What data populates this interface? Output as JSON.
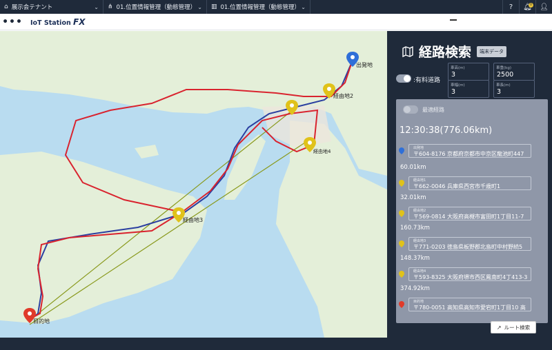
{
  "topbar": {
    "tenant": "展示会テナント",
    "menu1": "01.位置情報管理（動態管理）",
    "menu2": "01.位置情報管理（動態管理）",
    "badge": "0"
  },
  "header": {
    "logo_main": "IoT Station",
    "logo_fx": "FX"
  },
  "map": {
    "labels": {
      "origin": "出発地",
      "via2": "経由地2",
      "via3": "経由地3",
      "via4": "経由地4",
      "dest": "目的地"
    },
    "colors": {
      "route_red": "#d9232e",
      "route_blue": "#2b3fa0",
      "route_olive": "#8a9a1e",
      "water": "#b9dcf0",
      "land": "#e4efd9"
    }
  },
  "panel": {
    "title": "経路検索",
    "tag": "端末データ",
    "fields": {
      "height_label": "車高(m)",
      "height": "3",
      "weight_label": "車重(kg)",
      "weight": "2500",
      "width_label": "車幅(m)",
      "width": "3",
      "length_label": "車長(m)",
      "length": "3"
    },
    "toll_label": ":有料道路",
    "optimal_label": "最適経路",
    "total": "12:30:38(776.06km)",
    "stops": [
      {
        "label": "出発地",
        "addr": "〒604-8176 京都府京都市中京区龍池町447",
        "color": "#2f6fd8"
      },
      {
        "label": "経由地1",
        "addr": "〒662-0046 兵庫県西宮市千歳町1",
        "color": "#e0c21a"
      },
      {
        "label": "経由地2",
        "addr": "〒569-0814 大阪府高槻市富田町1丁目11-7",
        "color": "#e0c21a"
      },
      {
        "label": "経由地3",
        "addr": "〒771-0203 徳島県板野郡北島町中村野続5",
        "color": "#e0c21a"
      },
      {
        "label": "経由地4",
        "addr": "〒593-8325 大阪府堺市西区鳳南町4丁413-3",
        "color": "#e0c21a"
      },
      {
        "label": "目的地",
        "addr": "〒780-0051 高知県高知市愛宕町1丁目10 高",
        "color": "#e03a2a"
      }
    ],
    "distances": [
      "60.01km",
      "32.01km",
      "160.73km",
      "148.37km",
      "374.92km"
    ],
    "search_button": "ルート検索"
  }
}
